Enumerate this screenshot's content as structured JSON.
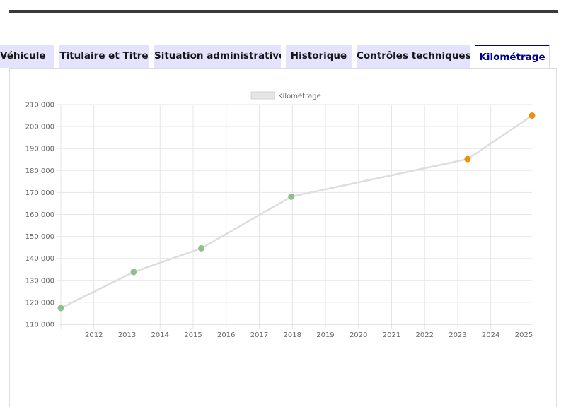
{
  "tabs": [
    {
      "label": "Véhicule",
      "active": false
    },
    {
      "label": "Titulaire et Titre",
      "active": false
    },
    {
      "label": "Situation administrative",
      "active": false
    },
    {
      "label": "Historique",
      "active": false
    },
    {
      "label": "Contrôles techniques",
      "active": false
    },
    {
      "label": "Kilométrage",
      "active": true
    }
  ],
  "colors": {
    "tab_bg": "#e3e3fd",
    "tab_active_text": "#000091",
    "line": "#dddddd",
    "point_green": "#8fbf8f",
    "point_orange": "#f0900a"
  },
  "chart_data": {
    "type": "line",
    "legend": [
      "Kilométrage"
    ],
    "legend_position": "top-center",
    "grid": true,
    "x_tick_labels": [
      "2012",
      "2013",
      "2014",
      "2015",
      "2016",
      "2017",
      "2018",
      "2019",
      "2020",
      "2021",
      "2022",
      "2023",
      "2024",
      "2025"
    ],
    "y_tick_labels": [
      "210 000",
      "200 000",
      "190 000",
      "180 000",
      "170 000",
      "160 000",
      "150 000",
      "140 000",
      "130 000",
      "120 000",
      "110 000"
    ],
    "xlim": [
      "2011-01-01",
      "2025-04-01"
    ],
    "ylim": [
      110000,
      210000
    ],
    "series": [
      {
        "name": "Kilométrage",
        "points": [
          {
            "x": "2011-01-01",
            "y": 117400,
            "color": "green"
          },
          {
            "x": "2013-03-15",
            "y": 133800,
            "color": "green"
          },
          {
            "x": "2015-04-01",
            "y": 144600,
            "color": "green"
          },
          {
            "x": "2017-12-20",
            "y": 168100,
            "color": "green"
          },
          {
            "x": "2023-04-20",
            "y": 185200,
            "color": "orange"
          },
          {
            "x": "2025-04-01",
            "y": 205000,
            "color": "orange"
          }
        ]
      }
    ]
  }
}
